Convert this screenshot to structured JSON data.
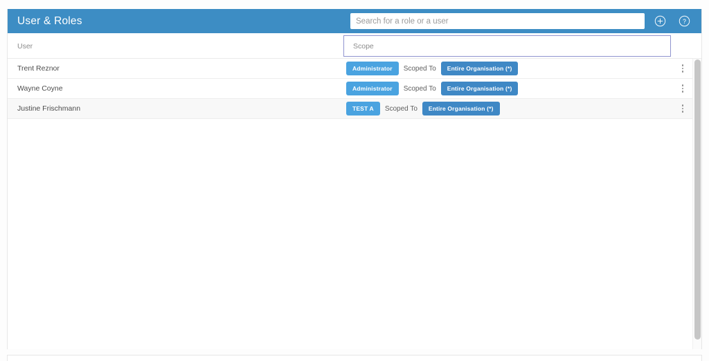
{
  "header": {
    "title": "User & Roles",
    "search": {
      "placeholder": "Search for a role or a user",
      "value": ""
    },
    "add_icon": "plus-circle-icon",
    "help_icon": "question-circle-icon",
    "background_color": "#3d8dc4"
  },
  "table": {
    "columns": {
      "user": "User",
      "scope": "Scope"
    },
    "scope_box_border_color": "#8f93cf",
    "scoped_to_label": "Scoped To",
    "rows": [
      {
        "user": "Trent Reznor",
        "role": "Administrator",
        "scoped_to": "Scoped To",
        "scope": "Entire Organisation (*)",
        "alt": false
      },
      {
        "user": "Wayne Coyne",
        "role": "Administrator",
        "scoped_to": "Scoped To",
        "scope": "Entire Organisation (*)",
        "alt": false
      },
      {
        "user": "Justine Frischmann",
        "role": "TEST A",
        "scoped_to": "Scoped To",
        "scope": "Entire Organisation (*)",
        "alt": true
      }
    ]
  },
  "colors": {
    "role_badge": "#4aa3e0",
    "scope_badge": "#3f88c5",
    "header_blue": "#3d8dc4",
    "alt_row": "#f8f8f8"
  }
}
